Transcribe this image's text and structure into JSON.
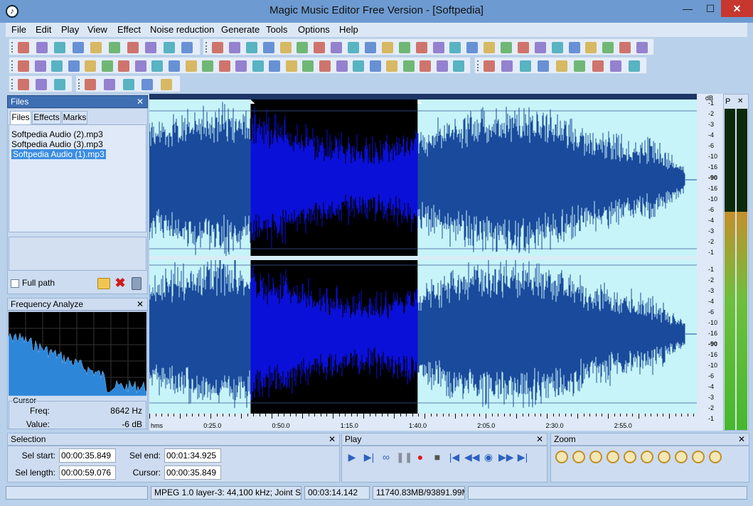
{
  "window": {
    "title": "Magic Music Editor Free Version - [Softpedia]",
    "minimize": "—",
    "maximize": "☐",
    "close": "✕"
  },
  "menu": [
    "File",
    "Edit",
    "Play",
    "View",
    "Effect",
    "Noise reduction",
    "Generate",
    "Tools",
    "Options",
    "Help"
  ],
  "files_panel": {
    "title": "Files",
    "tabs": [
      "Files",
      "Effects",
      "Marks"
    ],
    "items": [
      "Softpedia Audio (2).mp3",
      "Softpedia Audio (3).mp3",
      "Softpedia Audio (1).mp3"
    ],
    "selected_index": 2,
    "full_path_label": "Full path"
  },
  "freq_panel": {
    "title": "Frequency Analyze",
    "cursor_label": "Cursor",
    "freq_label": "Freq:",
    "freq_value": "8642 Hz",
    "value_label": "Value:",
    "value_value": "-6 dB"
  },
  "waveform": {
    "db_header": "dB",
    "db_scale": [
      "-1",
      "-2",
      "-3",
      "-4",
      "-6",
      "-10",
      "-16",
      "-90",
      "-16",
      "-10",
      "-6",
      "-4",
      "-3",
      "-2",
      "-1"
    ],
    "time_ticks": [
      "hms",
      "0:25.0",
      "0:50.0",
      "1:15.0",
      "1:40.0",
      "2:05.0",
      "2:30.0",
      "2:55.0"
    ],
    "selection_start": 0.185,
    "selection_end": 0.49,
    "colors": {
      "bg": "#c7f4f8",
      "wave": "#1a4a9c",
      "selection_bg": "#000000",
      "selection_wave": "#0a10d8"
    }
  },
  "meter": {
    "label": "P",
    "level": 0.68
  },
  "selection_panel": {
    "title": "Selection",
    "sel_start_label": "Sel start:",
    "sel_start": "00:00:35.849",
    "sel_end_label": "Sel end:",
    "sel_end": "00:01:34.925",
    "sel_length_label": "Sel length:",
    "sel_length": "00:00:59.076",
    "cursor_label": "Cursor:",
    "cursor": "00:00:35.849"
  },
  "play_panel": {
    "title": "Play"
  },
  "zoom_panel": {
    "title": "Zoom"
  },
  "status": {
    "format": "MPEG 1.0 layer-3: 44,100 kHz; Joint Stereo",
    "duration": "00:03:14.142",
    "memory": "11740.83MB/93891.99MB"
  }
}
